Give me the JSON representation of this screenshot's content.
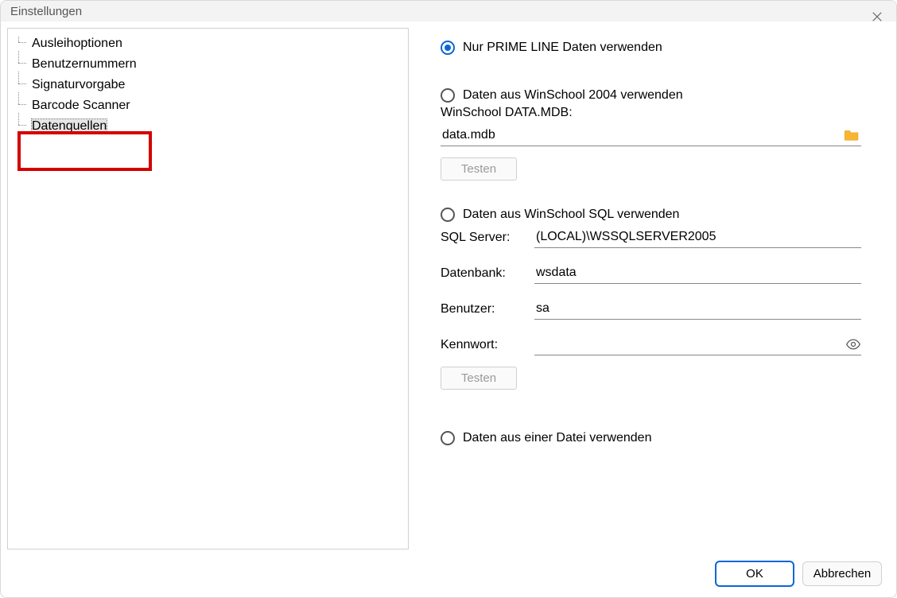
{
  "window": {
    "title": "Einstellungen"
  },
  "tree": {
    "items": [
      {
        "label": "Ausleihoptionen"
      },
      {
        "label": "Benutzernummern"
      },
      {
        "label": "Signaturvorgabe"
      },
      {
        "label": "Barcode Scanner"
      },
      {
        "label": "Datenquellen"
      }
    ],
    "selected_index": 4
  },
  "radio": {
    "prime_only": "Nur PRIME LINE Daten verwenden",
    "winschool_2004": "Daten aus WinSchool 2004 verwenden",
    "winschool_sql": "Daten aus WinSchool SQL verwenden",
    "from_file": "Daten aus einer Datei verwenden",
    "selected": "prime_only"
  },
  "winschool2004": {
    "label": "WinSchool DATA.MDB:",
    "value": "data.mdb",
    "test_btn": "Testen"
  },
  "sql": {
    "server_label": "SQL Server:",
    "server_value": "(LOCAL)\\WSSQLSERVER2005",
    "db_label": "Datenbank:",
    "db_value": "wsdata",
    "user_label": "Benutzer:",
    "user_value": "sa",
    "pw_label": "Kennwort:",
    "pw_value": "",
    "test_btn": "Testen"
  },
  "footer": {
    "ok": "OK",
    "cancel": "Abbrechen"
  },
  "icons": {
    "close": "close-icon",
    "folder": "folder-icon",
    "eye": "eye-icon"
  }
}
